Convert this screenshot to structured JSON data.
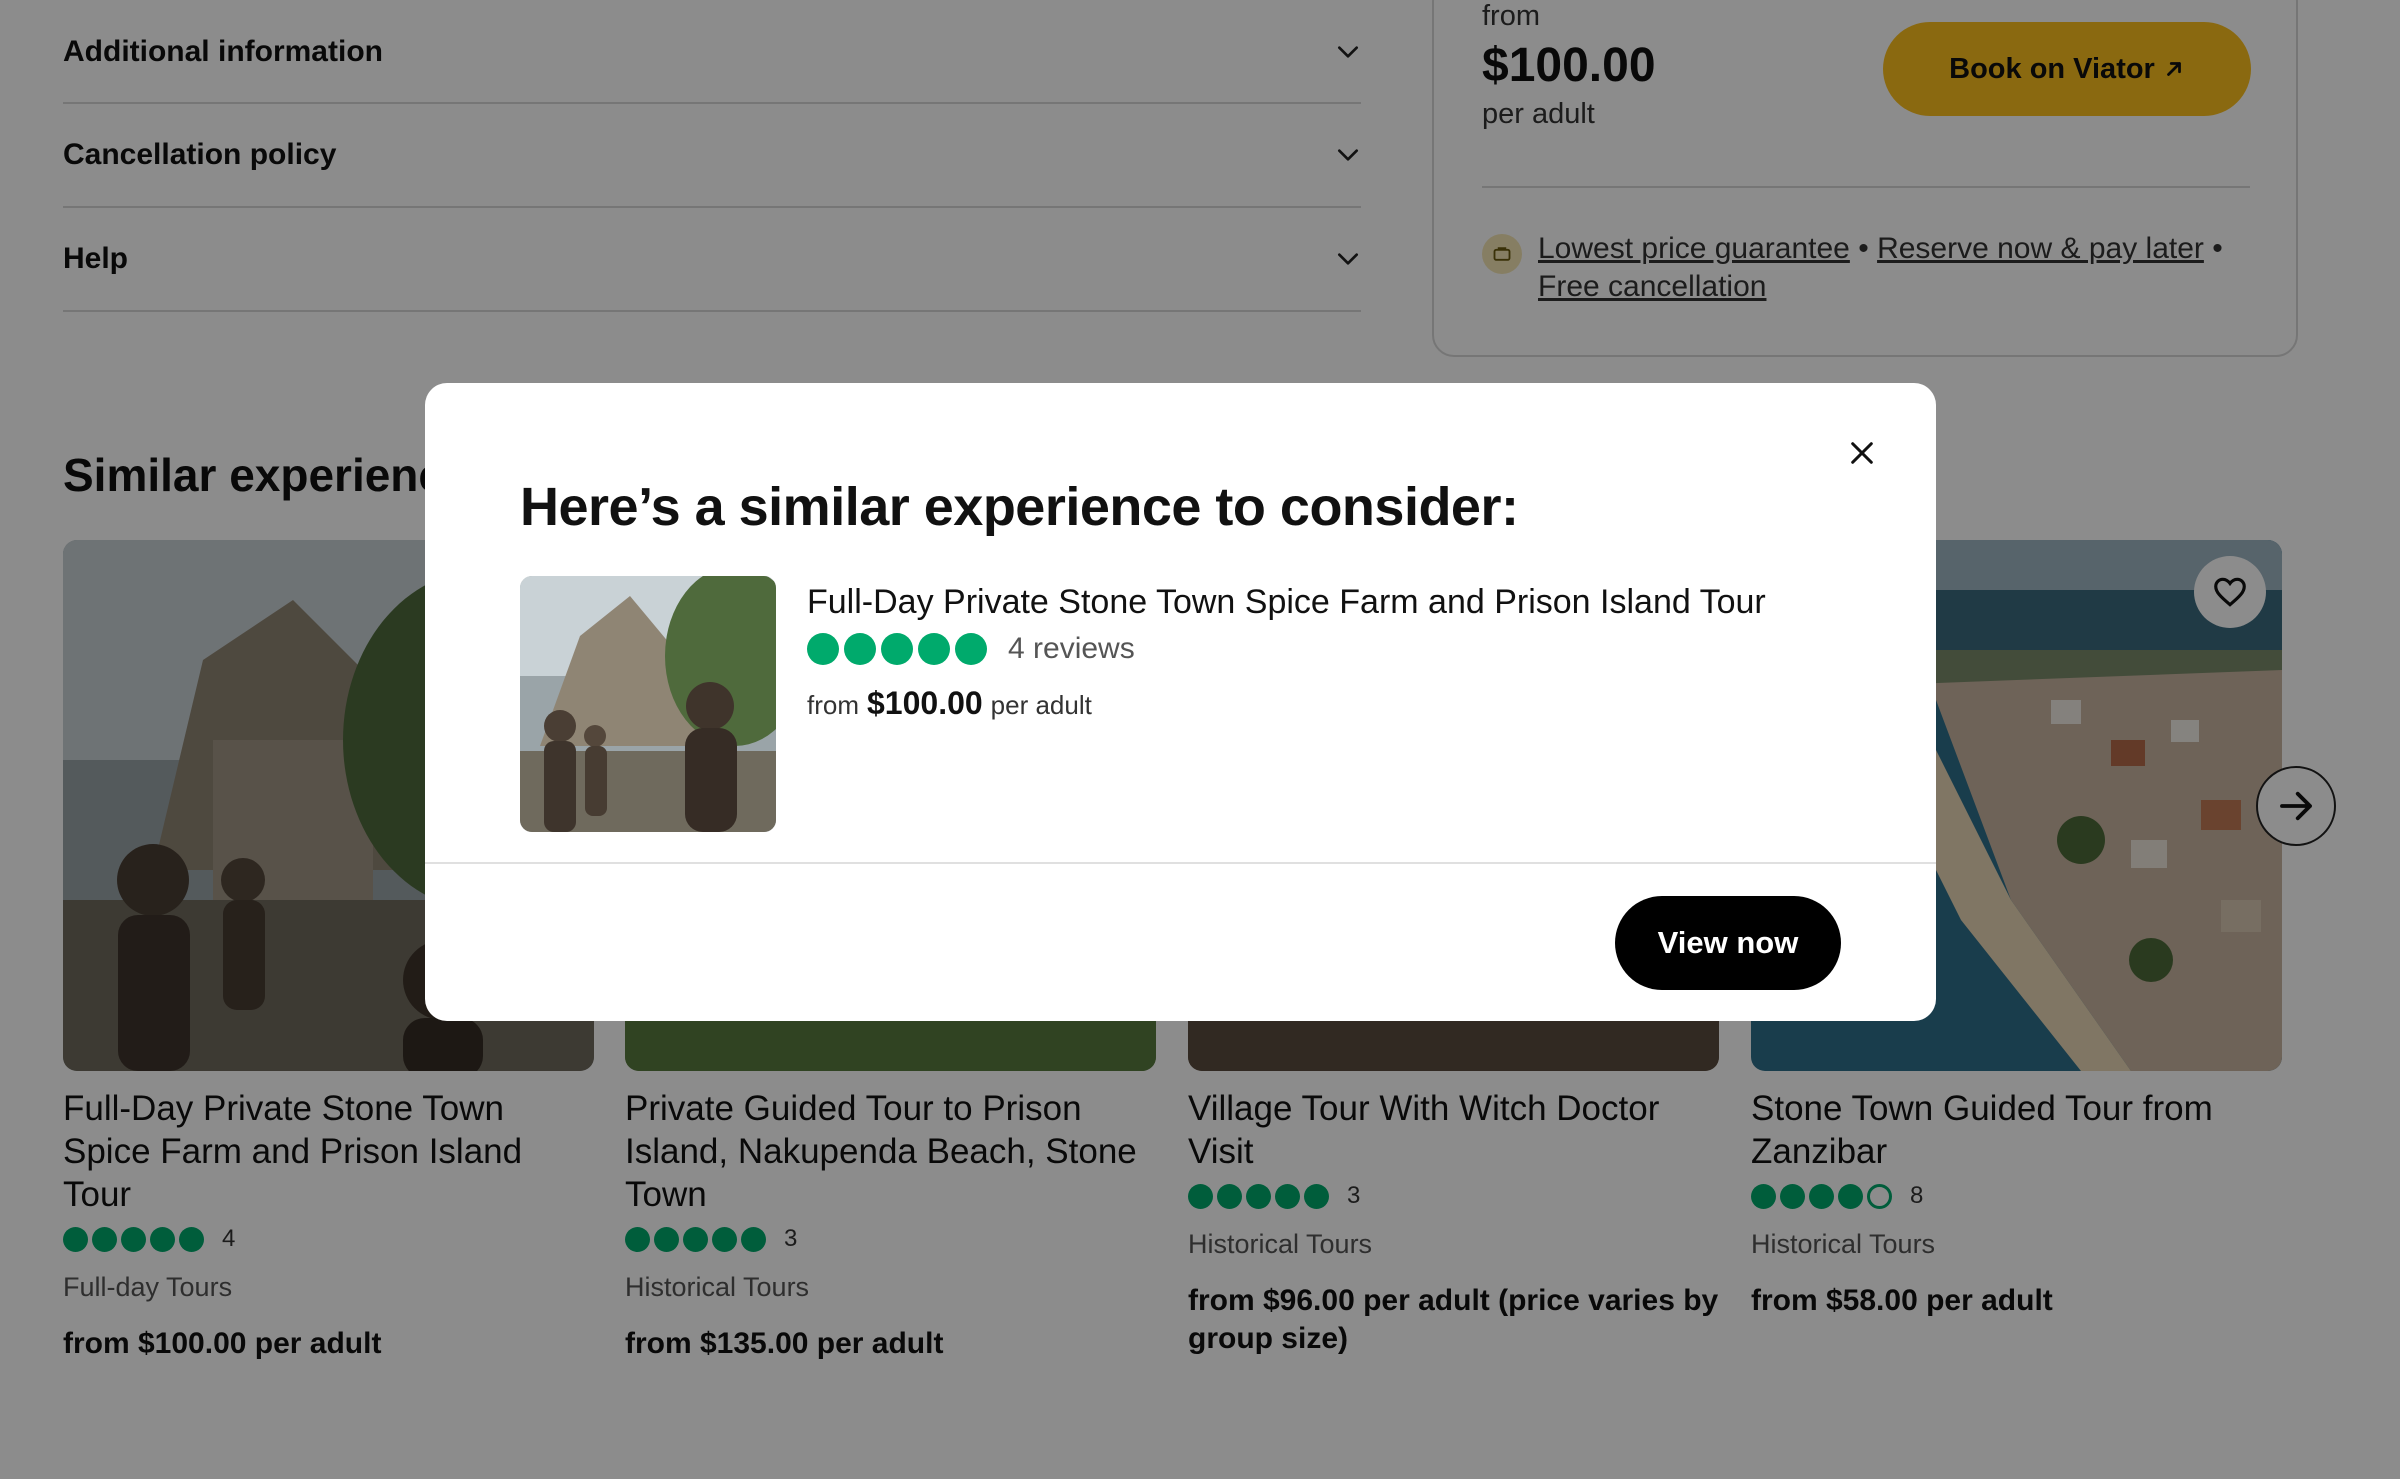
{
  "accordion": {
    "items": [
      {
        "label": "Additional information"
      },
      {
        "label": "Cancellation policy"
      },
      {
        "label": "Help"
      }
    ]
  },
  "price_card": {
    "from": "from",
    "price": "$100.00",
    "per": "per adult",
    "book_label": "Book on Viator",
    "guarantee_link_1": "Lowest price guarantee",
    "sep": " • ",
    "guarantee_link_2": "Reserve now & pay later",
    "guarantee_link_3": "Free cancellation"
  },
  "similar": {
    "title": "Similar experiences",
    "cards": [
      {
        "title": "Full-Day Private Stone Town Spice Farm and Prison Island Tour",
        "rating": 5,
        "count": "4",
        "category": "Full-day Tours",
        "price": "from $100.00 per adult"
      },
      {
        "title": "Private Guided Tour to Prison Island, Nakupenda Beach, Stone Town",
        "rating": 5,
        "count": "3",
        "category": "Historical Tours",
        "price": "from $135.00 per adult"
      },
      {
        "title": "Village Tour With Witch Doctor Visit",
        "rating": 5,
        "count": "3",
        "category": "Historical Tours",
        "price": "from $96.00 per adult (price varies by group size)"
      },
      {
        "title": "Stone Town Guided Tour from Zanzibar",
        "rating": 4,
        "count": "8",
        "category": "Historical Tours",
        "price": "from $58.00 per adult"
      }
    ]
  },
  "modal": {
    "title": "Here’s a similar experience to consider:",
    "tour_title": "Full-Day Private Stone Town Spice Farm and Prison Island Tour",
    "rating": 5,
    "reviews": "4 reviews",
    "from": "from",
    "price": "$100.00",
    "per": "per adult",
    "cta": "View now"
  },
  "colors": {
    "rating_green": "#00aa6c",
    "viator_yellow": "#fcbf1e",
    "cta_black": "#000000"
  },
  "icons": [
    "chevron-down-icon",
    "external-link-icon",
    "guarantee-icon",
    "heart-icon",
    "arrow-right-icon",
    "close-icon"
  ]
}
